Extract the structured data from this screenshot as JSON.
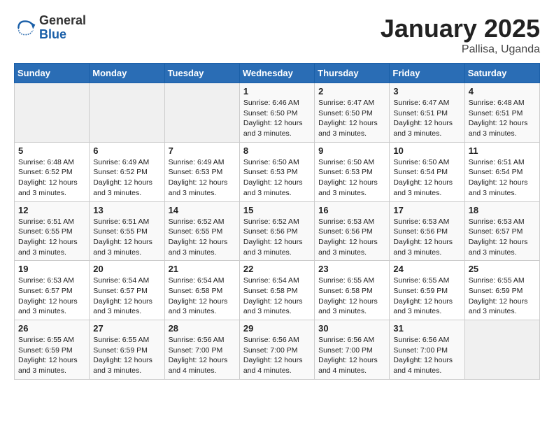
{
  "header": {
    "logo": {
      "general": "General",
      "blue": "Blue"
    },
    "title": "January 2025",
    "subtitle": "Pallisa, Uganda"
  },
  "days_of_week": [
    "Sunday",
    "Monday",
    "Tuesday",
    "Wednesday",
    "Thursday",
    "Friday",
    "Saturday"
  ],
  "weeks": [
    [
      {
        "day": "",
        "info": ""
      },
      {
        "day": "",
        "info": ""
      },
      {
        "day": "",
        "info": ""
      },
      {
        "day": "1",
        "info": "Sunrise: 6:46 AM\nSunset: 6:50 PM\nDaylight: 12 hours\nand 3 minutes."
      },
      {
        "day": "2",
        "info": "Sunrise: 6:47 AM\nSunset: 6:50 PM\nDaylight: 12 hours\nand 3 minutes."
      },
      {
        "day": "3",
        "info": "Sunrise: 6:47 AM\nSunset: 6:51 PM\nDaylight: 12 hours\nand 3 minutes."
      },
      {
        "day": "4",
        "info": "Sunrise: 6:48 AM\nSunset: 6:51 PM\nDaylight: 12 hours\nand 3 minutes."
      }
    ],
    [
      {
        "day": "5",
        "info": "Sunrise: 6:48 AM\nSunset: 6:52 PM\nDaylight: 12 hours\nand 3 minutes."
      },
      {
        "day": "6",
        "info": "Sunrise: 6:49 AM\nSunset: 6:52 PM\nDaylight: 12 hours\nand 3 minutes."
      },
      {
        "day": "7",
        "info": "Sunrise: 6:49 AM\nSunset: 6:53 PM\nDaylight: 12 hours\nand 3 minutes."
      },
      {
        "day": "8",
        "info": "Sunrise: 6:50 AM\nSunset: 6:53 PM\nDaylight: 12 hours\nand 3 minutes."
      },
      {
        "day": "9",
        "info": "Sunrise: 6:50 AM\nSunset: 6:53 PM\nDaylight: 12 hours\nand 3 minutes."
      },
      {
        "day": "10",
        "info": "Sunrise: 6:50 AM\nSunset: 6:54 PM\nDaylight: 12 hours\nand 3 minutes."
      },
      {
        "day": "11",
        "info": "Sunrise: 6:51 AM\nSunset: 6:54 PM\nDaylight: 12 hours\nand 3 minutes."
      }
    ],
    [
      {
        "day": "12",
        "info": "Sunrise: 6:51 AM\nSunset: 6:55 PM\nDaylight: 12 hours\nand 3 minutes."
      },
      {
        "day": "13",
        "info": "Sunrise: 6:51 AM\nSunset: 6:55 PM\nDaylight: 12 hours\nand 3 minutes."
      },
      {
        "day": "14",
        "info": "Sunrise: 6:52 AM\nSunset: 6:55 PM\nDaylight: 12 hours\nand 3 minutes."
      },
      {
        "day": "15",
        "info": "Sunrise: 6:52 AM\nSunset: 6:56 PM\nDaylight: 12 hours\nand 3 minutes."
      },
      {
        "day": "16",
        "info": "Sunrise: 6:53 AM\nSunset: 6:56 PM\nDaylight: 12 hours\nand 3 minutes."
      },
      {
        "day": "17",
        "info": "Sunrise: 6:53 AM\nSunset: 6:56 PM\nDaylight: 12 hours\nand 3 minutes."
      },
      {
        "day": "18",
        "info": "Sunrise: 6:53 AM\nSunset: 6:57 PM\nDaylight: 12 hours\nand 3 minutes."
      }
    ],
    [
      {
        "day": "19",
        "info": "Sunrise: 6:53 AM\nSunset: 6:57 PM\nDaylight: 12 hours\nand 3 minutes."
      },
      {
        "day": "20",
        "info": "Sunrise: 6:54 AM\nSunset: 6:57 PM\nDaylight: 12 hours\nand 3 minutes."
      },
      {
        "day": "21",
        "info": "Sunrise: 6:54 AM\nSunset: 6:58 PM\nDaylight: 12 hours\nand 3 minutes."
      },
      {
        "day": "22",
        "info": "Sunrise: 6:54 AM\nSunset: 6:58 PM\nDaylight: 12 hours\nand 3 minutes."
      },
      {
        "day": "23",
        "info": "Sunrise: 6:55 AM\nSunset: 6:58 PM\nDaylight: 12 hours\nand 3 minutes."
      },
      {
        "day": "24",
        "info": "Sunrise: 6:55 AM\nSunset: 6:59 PM\nDaylight: 12 hours\nand 3 minutes."
      },
      {
        "day": "25",
        "info": "Sunrise: 6:55 AM\nSunset: 6:59 PM\nDaylight: 12 hours\nand 3 minutes."
      }
    ],
    [
      {
        "day": "26",
        "info": "Sunrise: 6:55 AM\nSunset: 6:59 PM\nDaylight: 12 hours\nand 3 minutes."
      },
      {
        "day": "27",
        "info": "Sunrise: 6:55 AM\nSunset: 6:59 PM\nDaylight: 12 hours\nand 3 minutes."
      },
      {
        "day": "28",
        "info": "Sunrise: 6:56 AM\nSunset: 7:00 PM\nDaylight: 12 hours\nand 4 minutes."
      },
      {
        "day": "29",
        "info": "Sunrise: 6:56 AM\nSunset: 7:00 PM\nDaylight: 12 hours\nand 4 minutes."
      },
      {
        "day": "30",
        "info": "Sunrise: 6:56 AM\nSunset: 7:00 PM\nDaylight: 12 hours\nand 4 minutes."
      },
      {
        "day": "31",
        "info": "Sunrise: 6:56 AM\nSunset: 7:00 PM\nDaylight: 12 hours\nand 4 minutes."
      },
      {
        "day": "",
        "info": ""
      }
    ]
  ]
}
